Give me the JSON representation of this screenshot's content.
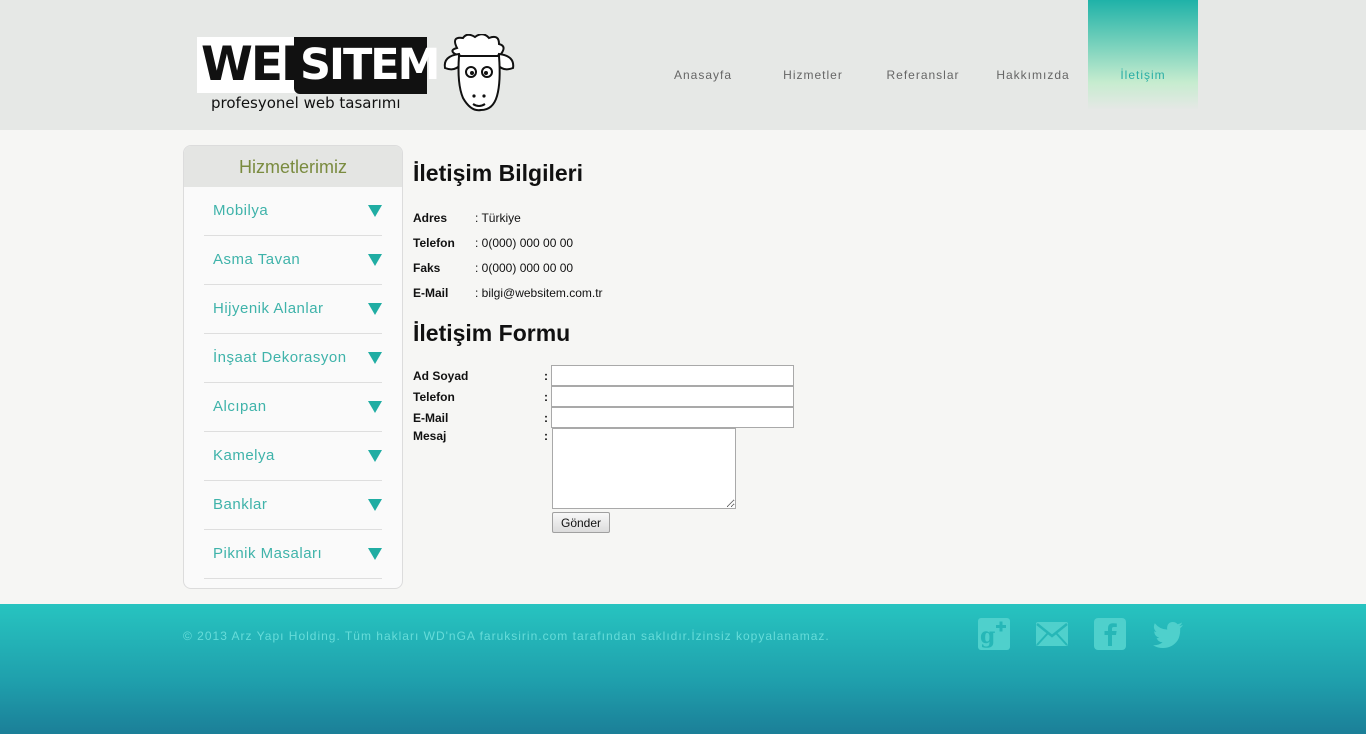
{
  "header": {
    "logo": {
      "word1": "WEB",
      "word2": "SITEM",
      "tagline": "profesyonel web tasarımı"
    },
    "nav": [
      {
        "label": "Anasayfa",
        "active": false
      },
      {
        "label": "Hizmetler",
        "active": false
      },
      {
        "label": "Referanslar",
        "active": false
      },
      {
        "label": "Hakkımızda",
        "active": false
      },
      {
        "label": "İletişim",
        "active": true
      }
    ]
  },
  "sidebar": {
    "title": "Hizmetlerimiz",
    "items": [
      {
        "label": "Mobilya"
      },
      {
        "label": "Asma Tavan"
      },
      {
        "label": "Hijyenik Alanlar"
      },
      {
        "label": "İnşaat Dekorasyon"
      },
      {
        "label": "Alcıpan"
      },
      {
        "label": "Kamelya"
      },
      {
        "label": "Banklar"
      },
      {
        "label": "Piknik Masaları"
      }
    ]
  },
  "contact": {
    "title": "İletişim Bilgileri",
    "rows": [
      {
        "key": "Adres",
        "value": ": Türkiye"
      },
      {
        "key": "Telefon",
        "value": ": 0(000) 000 00 00"
      },
      {
        "key": "Faks",
        "value": ": 0(000) 000 00 00"
      },
      {
        "key": "E-Mail",
        "value": ": bilgi@websitem.com.tr"
      }
    ]
  },
  "form": {
    "title": "İletişim Formu",
    "fields": [
      {
        "label": "Ad Soyad",
        "value": ""
      },
      {
        "label": "Telefon",
        "value": ""
      },
      {
        "label": "E-Mail",
        "value": ""
      },
      {
        "label": "Mesaj",
        "value": ""
      }
    ],
    "colon": ":",
    "submit": "Gönder"
  },
  "footer": {
    "copyright": "© 2013 Arz Yapı Holding. Tüm hakları WD'nGA faruksirin.com tarafından saklıdır.İzinsiz kopyalanamaz.",
    "social": [
      "google-plus-icon",
      "mail-icon",
      "facebook-icon",
      "twitter-icon"
    ]
  },
  "colors": {
    "accent": "#20ada3",
    "sidebar_title": "#7a8b3f",
    "footer_top": "#27c4c0",
    "footer_bottom": "#1b7f98"
  }
}
